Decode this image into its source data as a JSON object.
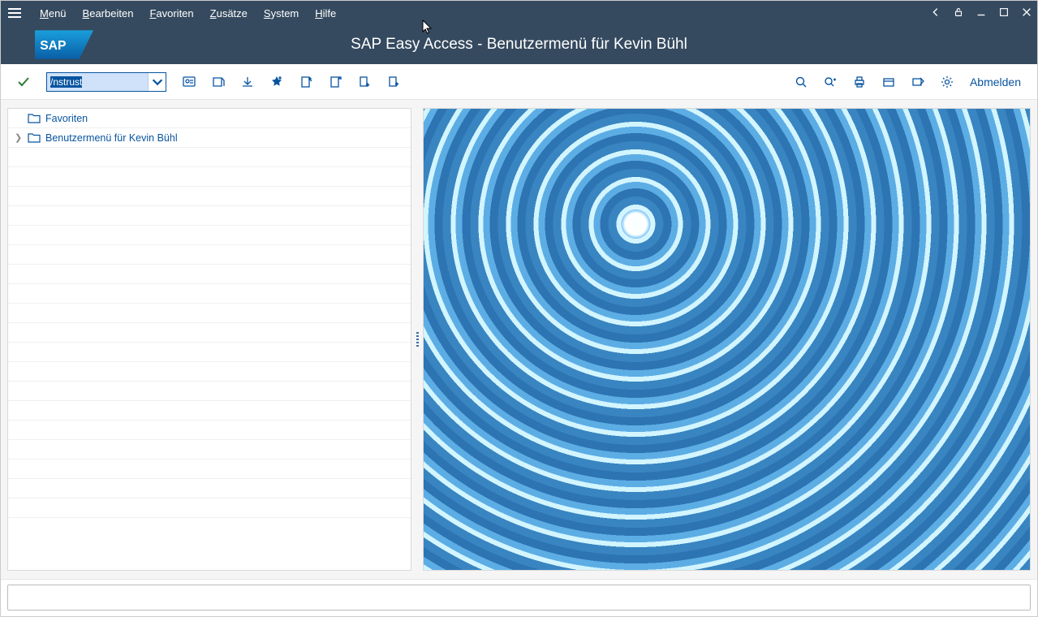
{
  "menu": {
    "items": [
      "Menü",
      "Bearbeiten",
      "Favoriten",
      "Zusätze",
      "System",
      "Hilfe"
    ]
  },
  "title": "SAP Easy Access  -  Benutzermenü für Kevin Bühl",
  "toolbar": {
    "tcode_value": "/nstrust",
    "logout_label": "Abmelden"
  },
  "tree": {
    "rows": [
      {
        "label": "Favoriten",
        "expandable": false
      },
      {
        "label": "Benutzermenü für Kevin Bühl",
        "expandable": true
      }
    ]
  },
  "status": {
    "value": ""
  }
}
